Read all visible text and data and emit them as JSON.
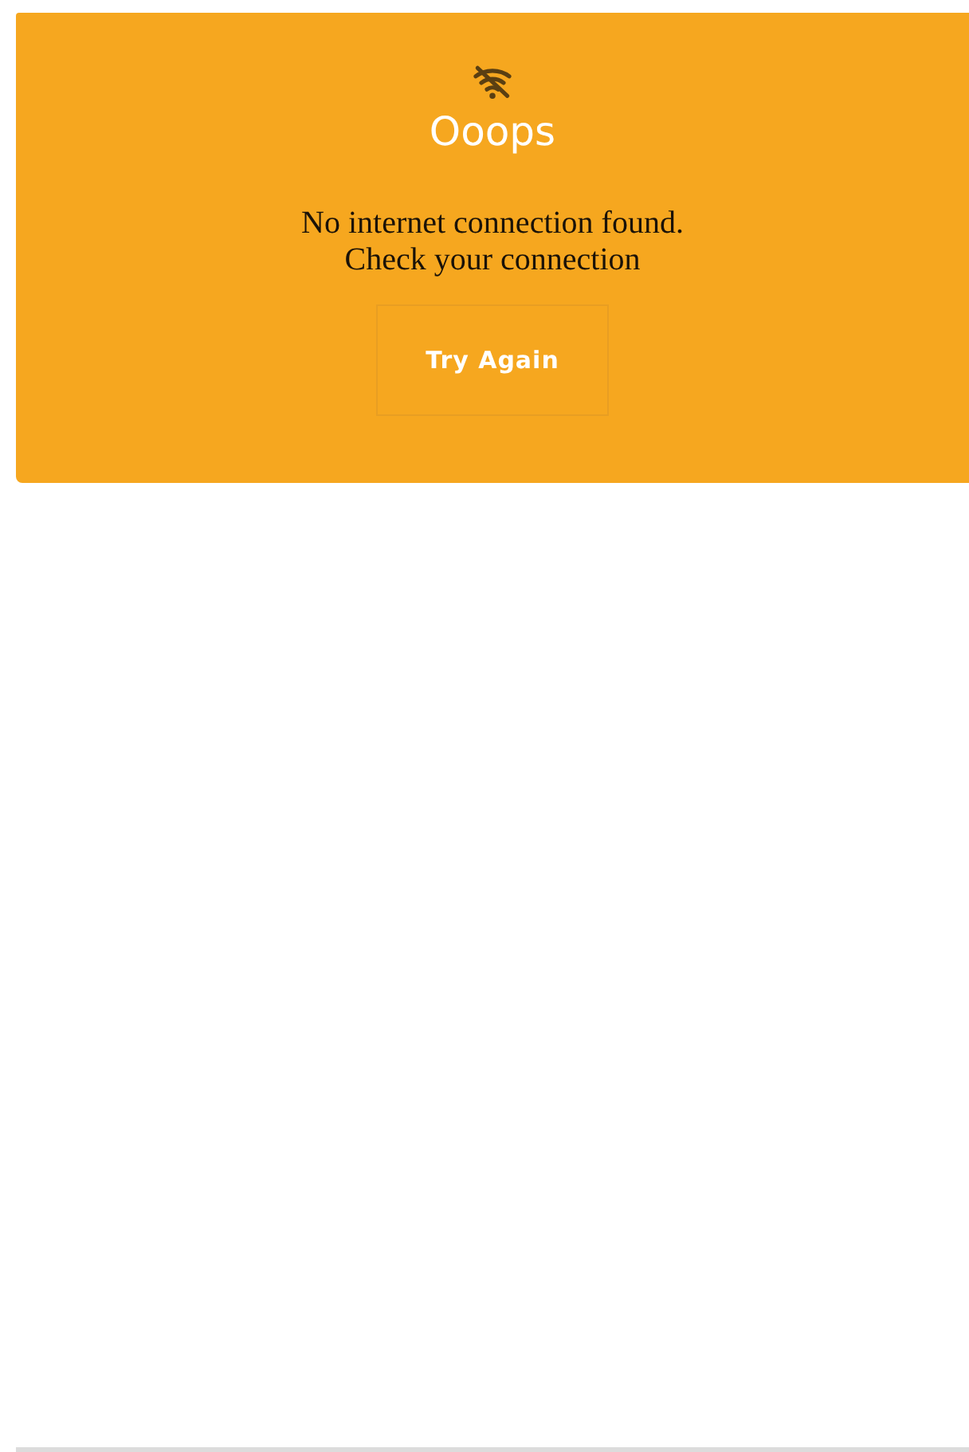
{
  "error_card": {
    "title": "Ooops",
    "message_lines": [
      "No internet connection found.",
      "Check your connection"
    ],
    "button": "Try Again"
  }
}
